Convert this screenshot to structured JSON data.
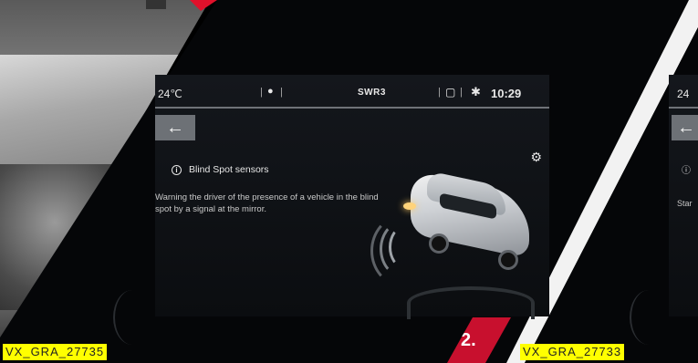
{
  "status_bar": {
    "temperature": "24℃",
    "location_icon": "location-pin-icon",
    "radio_station": "SWR3",
    "book_icon": "book-icon",
    "settings_icon": "gear-icon",
    "time": "10:29"
  },
  "navigation": {
    "back_arrow": "←",
    "back_icon": "back-arrow-icon"
  },
  "feature": {
    "title": "Blind Spot sensors",
    "info_icon": "info-icon",
    "description": "Warning the driver of the presence of a vehicle in the blind spot by a signal at the mirror.",
    "sensor_icon": "blind-spot-sensor-icon"
  },
  "second_screen": {
    "temperature_partial": "24",
    "start_text_partial": "Star",
    "info_icon": "info-icon"
  },
  "labels": {
    "left_tag": "VX_GRA_27735",
    "right_tag": "VX_GRA_27733",
    "step_number": "2."
  },
  "colors": {
    "accent_red": "#c8102e",
    "tag_yellow": "#ffff00",
    "screen_bg": "#0b0d10",
    "back_button": "#6d7176"
  }
}
